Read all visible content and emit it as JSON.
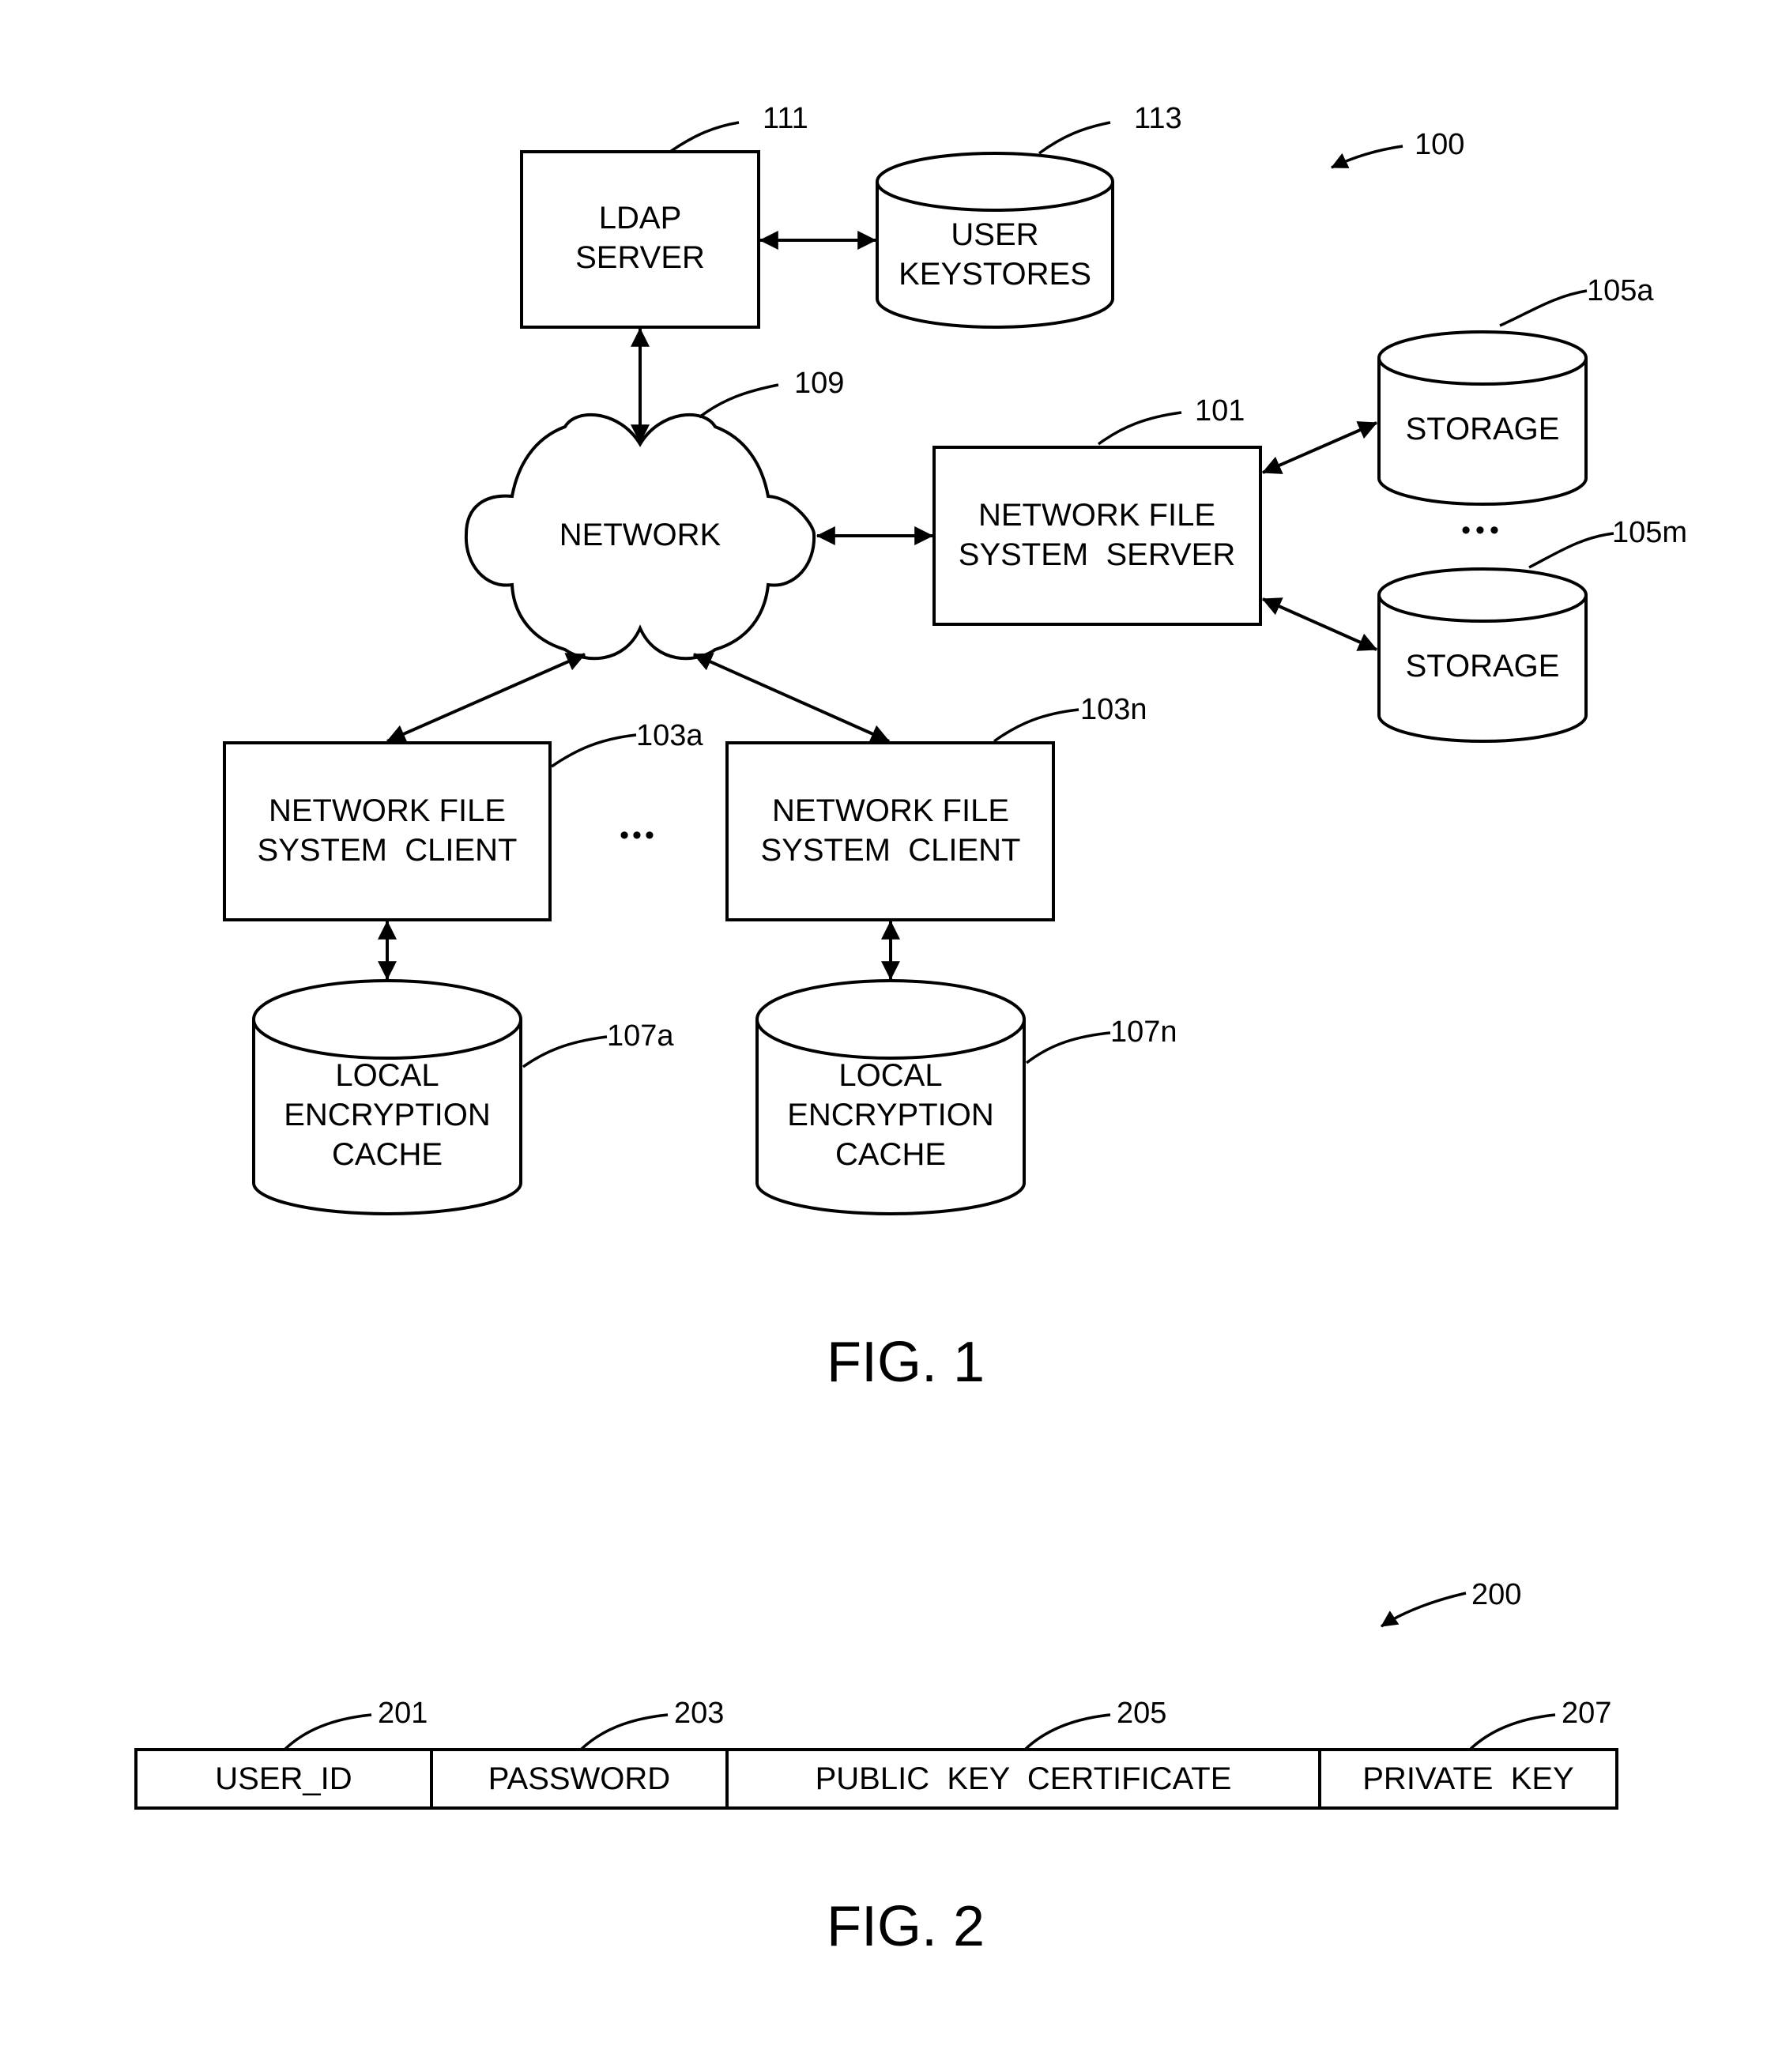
{
  "figure1": {
    "caption": "FIG. 1",
    "system_ref": "100",
    "ldap_server": {
      "ref": "111",
      "lines": [
        "LDAP",
        "SERVER"
      ]
    },
    "user_keystores": {
      "ref": "113",
      "lines": [
        "USER",
        "KEYSTORES"
      ]
    },
    "network": {
      "ref": "109",
      "label": "NETWORK"
    },
    "nfs_server": {
      "ref": "101",
      "lines": [
        "NETWORK FILE",
        "SYSTEM  SERVER"
      ]
    },
    "storage_a": {
      "ref": "105a",
      "label": "STORAGE"
    },
    "storage_m": {
      "ref": "105m",
      "label": "STORAGE"
    },
    "storage_ellipsis": "•••",
    "client_a": {
      "ref": "103a",
      "lines": [
        "NETWORK FILE",
        "SYSTEM  CLIENT"
      ]
    },
    "client_n": {
      "ref": "103n",
      "lines": [
        "NETWORK FILE",
        "SYSTEM  CLIENT"
      ]
    },
    "client_ellipsis": "•••",
    "cache_a": {
      "ref": "107a",
      "lines": [
        "LOCAL",
        "ENCRYPTION",
        "CACHE"
      ]
    },
    "cache_n": {
      "ref": "107n",
      "lines": [
        "LOCAL",
        "ENCRYPTION",
        "CACHE"
      ]
    }
  },
  "figure2": {
    "caption": "FIG. 2",
    "record_ref": "200",
    "fields": [
      {
        "ref": "201",
        "label": "USER_ID"
      },
      {
        "ref": "203",
        "label": "PASSWORD"
      },
      {
        "ref": "205",
        "label": "PUBLIC  KEY  CERTIFICATE"
      },
      {
        "ref": "207",
        "label": "PRIVATE  KEY"
      }
    ]
  }
}
